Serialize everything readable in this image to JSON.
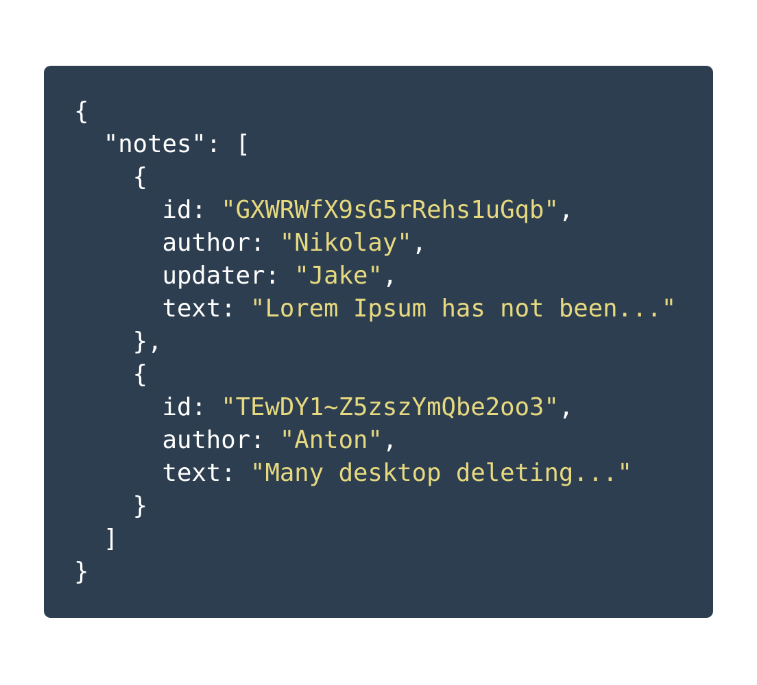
{
  "colors": {
    "background": "#2d3e50",
    "text": "#ffffff",
    "string": "#e6d97f"
  },
  "code": {
    "lines": [
      {
        "parts": [
          {
            "t": "{",
            "s": false
          }
        ]
      },
      {
        "parts": [
          {
            "t": "  \"notes\": [",
            "s": false
          }
        ]
      },
      {
        "parts": [
          {
            "t": "    {",
            "s": false
          }
        ]
      },
      {
        "parts": [
          {
            "t": "      id: ",
            "s": false
          },
          {
            "t": "\"GXWRWfX9sG5rRehs1uGqb\"",
            "s": true
          },
          {
            "t": ",",
            "s": false
          }
        ]
      },
      {
        "parts": [
          {
            "t": "      author: ",
            "s": false
          },
          {
            "t": "\"Nikolay\"",
            "s": true
          },
          {
            "t": ",",
            "s": false
          }
        ]
      },
      {
        "parts": [
          {
            "t": "      updater: ",
            "s": false
          },
          {
            "t": "\"Jake\"",
            "s": true
          },
          {
            "t": ",",
            "s": false
          }
        ]
      },
      {
        "parts": [
          {
            "t": "      text: ",
            "s": false
          },
          {
            "t": "\"Lorem Ipsum has not been...\"",
            "s": true
          }
        ]
      },
      {
        "parts": [
          {
            "t": "    },",
            "s": false
          }
        ]
      },
      {
        "parts": [
          {
            "t": "    {",
            "s": false
          }
        ]
      },
      {
        "parts": [
          {
            "t": "      id: ",
            "s": false
          },
          {
            "t": "\"TEwDY1~Z5zszYmQbe2oo3\"",
            "s": true
          },
          {
            "t": ",",
            "s": false
          }
        ]
      },
      {
        "parts": [
          {
            "t": "      author: ",
            "s": false
          },
          {
            "t": "\"Anton\"",
            "s": true
          },
          {
            "t": ",",
            "s": false
          }
        ]
      },
      {
        "parts": [
          {
            "t": "      text: ",
            "s": false
          },
          {
            "t": "\"Many desktop deleting...\"",
            "s": true
          }
        ]
      },
      {
        "parts": [
          {
            "t": "    }",
            "s": false
          }
        ]
      },
      {
        "parts": [
          {
            "t": "  ]",
            "s": false
          }
        ]
      },
      {
        "parts": [
          {
            "t": "}",
            "s": false
          }
        ]
      }
    ]
  }
}
